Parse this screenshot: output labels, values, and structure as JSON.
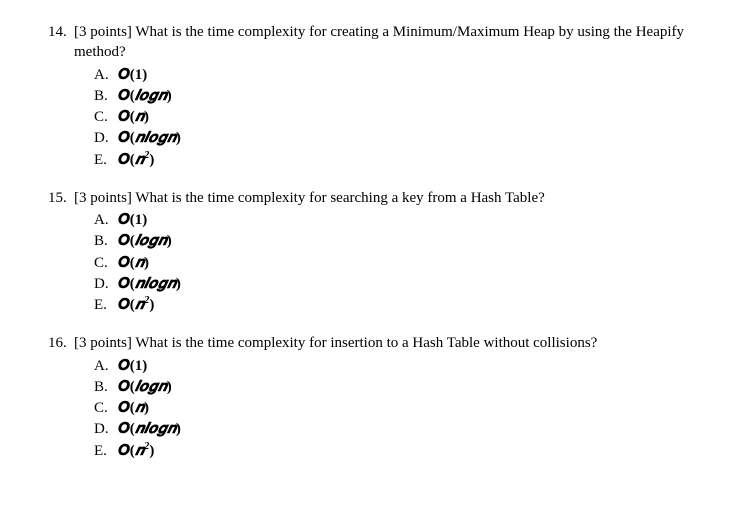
{
  "questions": [
    {
      "number": "14.",
      "points": "[3 points]",
      "text": "What is the time complexity for creating a Minimum/Maximum Heap by using the Heapify method?",
      "options": [
        {
          "label": "A.",
          "value": "O(1)",
          "type": "o1"
        },
        {
          "label": "B.",
          "value": "O(logn)",
          "type": "ologn"
        },
        {
          "label": "C.",
          "value": "O(n)",
          "type": "on"
        },
        {
          "label": "D.",
          "value": "O(nlogn)",
          "type": "onlogn"
        },
        {
          "label": "E.",
          "value": "O(n²)",
          "type": "on2"
        }
      ]
    },
    {
      "number": "15.",
      "points": "[3 points]",
      "text": "What is the time complexity for searching a key from a Hash Table?",
      "options": [
        {
          "label": "A.",
          "value": "O(1)",
          "type": "o1"
        },
        {
          "label": "B.",
          "value": "O(logn)",
          "type": "ologn"
        },
        {
          "label": "C.",
          "value": "O(n)",
          "type": "on"
        },
        {
          "label": "D.",
          "value": "O(nlogn)",
          "type": "onlogn"
        },
        {
          "label": "E.",
          "value": "O(n²)",
          "type": "on2"
        }
      ]
    },
    {
      "number": "16.",
      "points": "[3 points]",
      "text": "What is the time complexity for insertion to a Hash Table without collisions?",
      "options": [
        {
          "label": "A.",
          "value": "O(1)",
          "type": "o1"
        },
        {
          "label": "B.",
          "value": "O(logn)",
          "type": "ologn"
        },
        {
          "label": "C.",
          "value": "O(n)",
          "type": "on"
        },
        {
          "label": "D.",
          "value": "O(nlogn)",
          "type": "onlogn"
        },
        {
          "label": "E.",
          "value": "O(n²)",
          "type": "on2"
        }
      ]
    }
  ]
}
